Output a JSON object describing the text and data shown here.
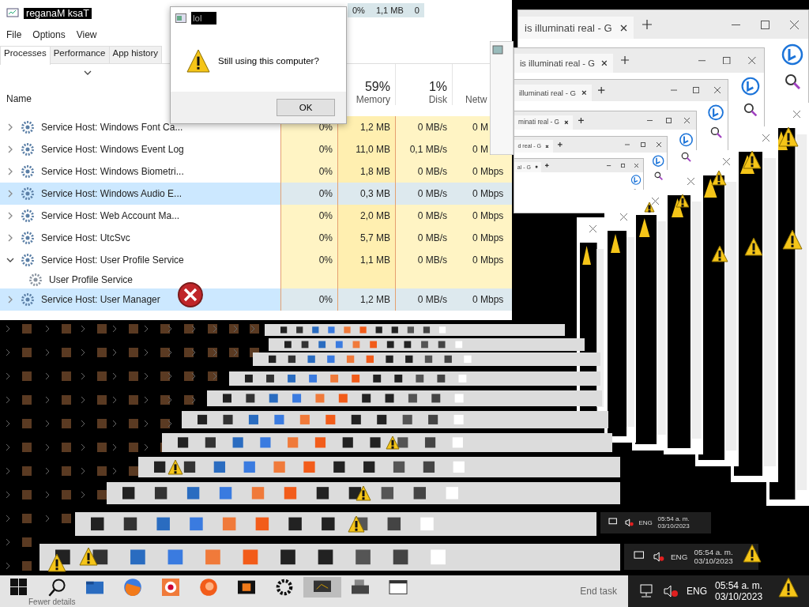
{
  "task_manager": {
    "title": "reganaM ksaT",
    "menu": [
      "File",
      "Options",
      "View"
    ],
    "tabs": [
      {
        "label": "Processes",
        "selected": true
      },
      {
        "label": "Performance",
        "selected": false
      },
      {
        "label": "App history",
        "selected": false
      }
    ],
    "ghost_row": [
      "0%",
      "1,1 MB",
      "0"
    ],
    "columns": [
      {
        "label": "Name"
      },
      {
        "label": "Memory",
        "reading": "59%"
      },
      {
        "label": "Disk",
        "reading": "1%"
      },
      {
        "label": "Netw"
      }
    ],
    "rows": [
      {
        "name": "Service Host: Windows Font Ca...",
        "cpu": "0%",
        "memory": "1,2 MB",
        "disk": "0 MB/s",
        "network": "0 M",
        "selected": false,
        "expanded": false
      },
      {
        "name": "Service Host: Windows Event Log",
        "cpu": "0%",
        "memory": "11,0 MB",
        "disk": "0,1 MB/s",
        "network": "0 M",
        "selected": false,
        "expanded": false
      },
      {
        "name": "Service Host: Windows Biometri...",
        "cpu": "0%",
        "memory": "1,8 MB",
        "disk": "0 MB/s",
        "network": "0 Mbps",
        "selected": false,
        "expanded": false
      },
      {
        "name": "Service Host: Windows Audio E...",
        "cpu": "0%",
        "memory": "0,3 MB",
        "disk": "0 MB/s",
        "network": "0 Mbps",
        "selected": true,
        "expanded": false
      },
      {
        "name": "Service Host: Web Account Ma...",
        "cpu": "0%",
        "memory": "2,0 MB",
        "disk": "0 MB/s",
        "network": "0 Mbps",
        "selected": false,
        "expanded": false
      },
      {
        "name": "Service Host: UtcSvc",
        "cpu": "0%",
        "memory": "5,7 MB",
        "disk": "0 MB/s",
        "network": "0 Mbps",
        "selected": false,
        "expanded": false
      },
      {
        "name": "Service Host: User Profile Service",
        "cpu": "0%",
        "memory": "1,1 MB",
        "disk": "0 MB/s",
        "network": "0 Mbps",
        "selected": false,
        "expanded": true,
        "children": [
          {
            "name": "User Profile Service"
          }
        ]
      },
      {
        "name": "Service Host: User Manager",
        "cpu": "0%",
        "memory": "1,2 MB",
        "disk": "0 MB/s",
        "network": "0 Mbps",
        "selected": true,
        "expanded": false
      }
    ]
  },
  "dialog": {
    "title": "lol",
    "message": "Still using this computer?",
    "button": "OK"
  },
  "browser_windows": [
    {
      "tab_title": "is illuminati real - G"
    },
    {
      "tab_title": "is illuminati real - G"
    },
    {
      "tab_title": "illuminati real - G"
    },
    {
      "tab_title": "minati real - G"
    },
    {
      "tab_title": "d real - G"
    },
    {
      "tab_title": "al - G"
    }
  ],
  "taskbar": {
    "left_text": "Fewer details",
    "right_text": "End task",
    "language": "ENG",
    "time": "05:54 a. m.",
    "date": "03/10/2023"
  },
  "tray_echoes": [
    {
      "language": "ENG",
      "time": "05:54 a. m.",
      "date": "03/10/2023"
    },
    {
      "language": "ENG",
      "time": "05:54 a. m.",
      "date": "03/10/2023"
    }
  ]
}
